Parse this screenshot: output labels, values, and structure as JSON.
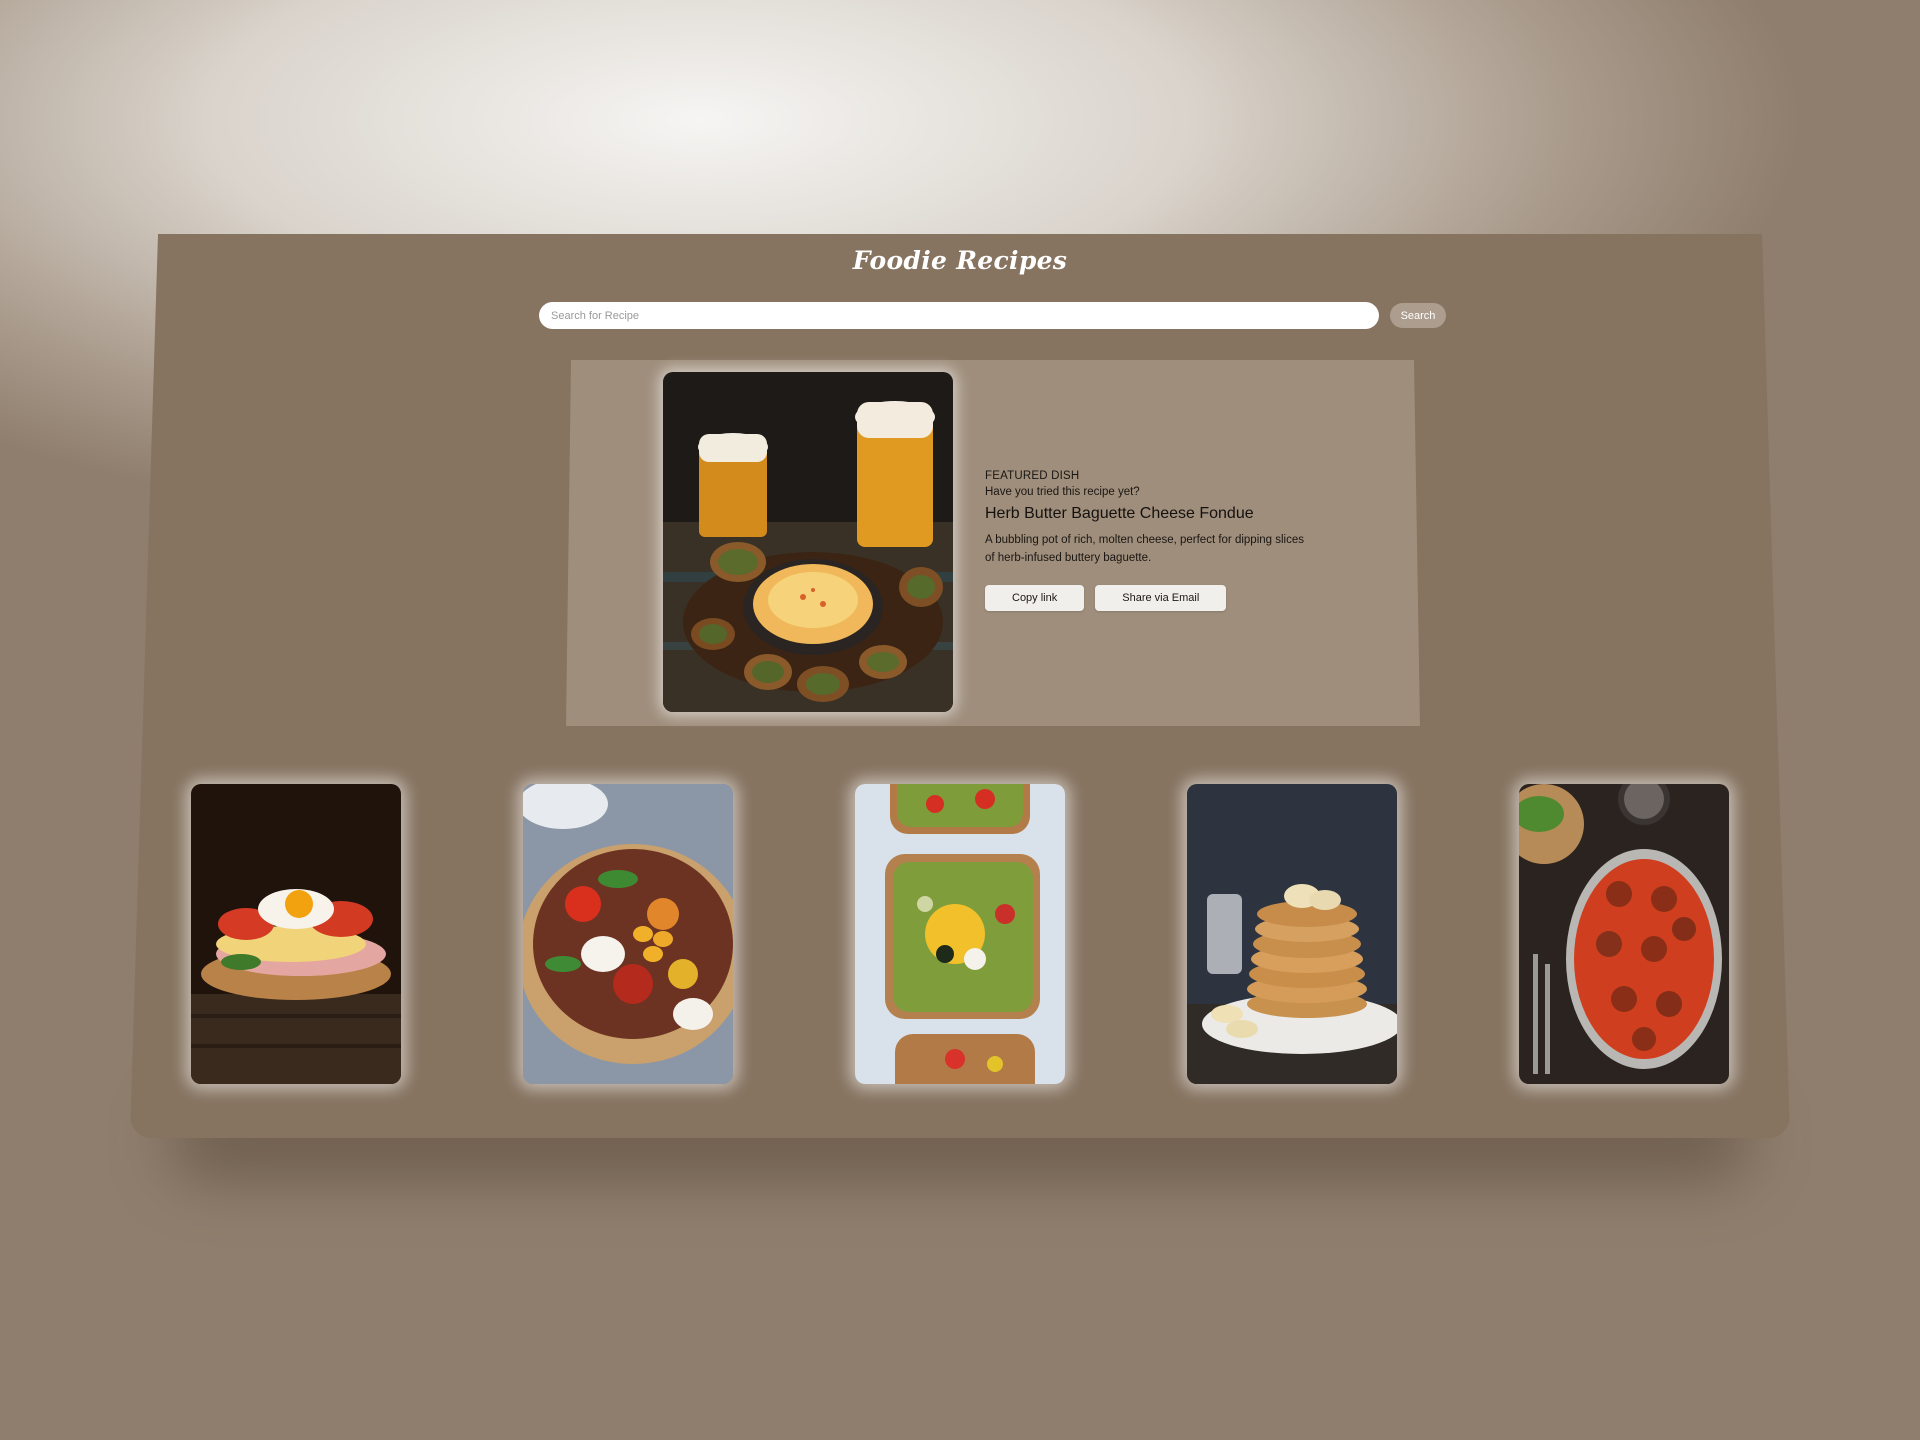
{
  "app": {
    "title": "Foodie Recipes"
  },
  "search": {
    "placeholder": "Search for Recipe",
    "value": "",
    "button_label": "Search"
  },
  "featured": {
    "label": "FEATURED DISH",
    "prompt": "Have you tried this recipe yet?",
    "dish_title": "Herb Butter Baguette Cheese Fondue",
    "description": "A bubbling pot of rich, molten cheese, perfect for dipping slices of herb-infused buttery baguette.",
    "copy_link_label": "Copy link",
    "share_email_label": "Share via Email"
  },
  "recipe_cards": [
    {
      "image": "egg-ham-sandwich-photo"
    },
    {
      "image": "tomato-burrata-salad-photo"
    },
    {
      "image": "avocado-toast-photo"
    },
    {
      "image": "banana-pancakes-photo"
    },
    {
      "image": "meatballs-tomato-sauce-photo"
    }
  ],
  "colors": {
    "panel": "#867360",
    "featured_panel": "#9f8e7c",
    "search_button": "#ad9d8e"
  }
}
